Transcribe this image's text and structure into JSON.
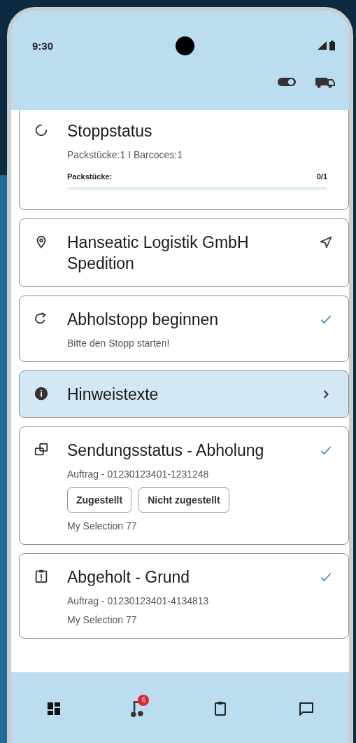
{
  "status_bar": {
    "time": "9:30"
  },
  "cards": [
    {
      "kind": "progress",
      "title": "Stoppstatus",
      "subtitle": "Packstücke:1 I Barcoces:1",
      "progress": {
        "label": "Packstücke:",
        "reading": "0/1",
        "level": 0
      },
      "done": false,
      "highlighted": false
    },
    {
      "kind": "address",
      "title": "Hanseatic Logistik GmbH Spedition",
      "done": false,
      "highlighted": false
    },
    {
      "kind": "start",
      "title": "Abholstopp beginnen",
      "subtitle": "Bitte den Stopp starten!",
      "done": true,
      "highlighted": false
    },
    {
      "kind": "info",
      "title": "Hinweistexte",
      "done": false,
      "highlighted": true
    },
    {
      "kind": "shipment",
      "title": "Sendungsstatus - Abholung",
      "subtitle": "Auftrag - 01230123401-1231248",
      "buttons": [
        "Zugestellt",
        "Nicht zugestellt"
      ],
      "note": "My Selection 77",
      "done": true,
      "highlighted": false
    },
    {
      "kind": "reason",
      "title": "Abgeholt - Grund",
      "subtitle": "Auftrag - 01230123401-4134813",
      "note": "My Selection 77",
      "done": true,
      "highlighted": false
    }
  ],
  "bottom_nav": [
    {
      "kind": "dashboard"
    },
    {
      "kind": "route",
      "badge": "6"
    },
    {
      "kind": "clipboard"
    },
    {
      "kind": "chat"
    }
  ]
}
